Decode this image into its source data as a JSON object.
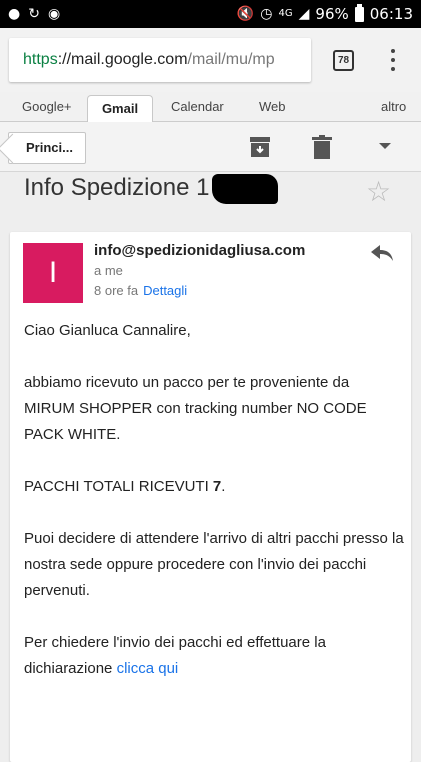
{
  "status_bar": {
    "battery": "96%",
    "time": "06:13",
    "network": "4G"
  },
  "browser": {
    "url_scheme": "https",
    "url_host": "mail.google.com",
    "url_path": "/mail/mu/mp",
    "tab_count": "78"
  },
  "google_bar": {
    "items": [
      "Google+",
      "Gmail",
      "Calendar",
      "Web",
      "altro"
    ],
    "active": "Gmail"
  },
  "toolbar": {
    "back_label": "Princi..."
  },
  "email": {
    "subject": "Info Spedizione 1",
    "avatar_letter": "I",
    "avatar_color": "#d81b60",
    "sender": "info@spedizionidagliusa.com",
    "to": "a me",
    "time": "8 ore fa",
    "details_label": "Dettagli",
    "greeting": "Ciao Gianluca Cannalire,",
    "para1": "abbiamo ricevuto un pacco per te proveniente da MIRUM SHOPPER con tracking number NO CODE PACK WHITE.",
    "para2_prefix": "PACCHI TOTALI RICEVUTI ",
    "para2_count": "7",
    "para2_suffix": ".",
    "para3": "Puoi decidere di attendere l'arrivo di altri pacchi presso la nostra sede oppure procedere con l'invio dei pacchi pervenuti.",
    "para4_prefix": "Per chiedere l'invio dei pacchi ed effettuare la dichiarazione ",
    "para4_link": "clicca qui"
  }
}
